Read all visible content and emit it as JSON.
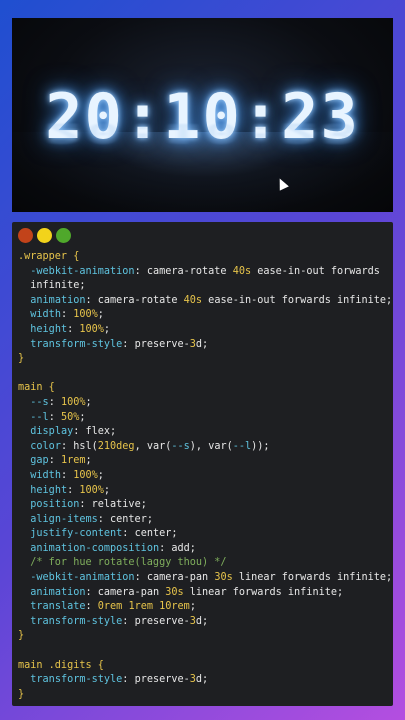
{
  "preview": {
    "clock_text": "20:10:23"
  },
  "editor": {
    "lines": [
      ".wrapper {",
      "  -webkit-animation: camera-rotate 40s ease-in-out forwards",
      "  infinite;",
      "  animation: camera-rotate 40s ease-in-out forwards infinite;",
      "  width: 100%;",
      "  height: 100%;",
      "  transform-style: preserve-3d;",
      "}",
      "",
      "main {",
      "  --s: 100%;",
      "  --l: 50%;",
      "  display: flex;",
      "  color: hsl(210deg, var(--s), var(--l));",
      "  gap: 1rem;",
      "  width: 100%;",
      "  height: 100%;",
      "  position: relative;",
      "  align-items: center;",
      "  justify-content: center;",
      "  animation-composition: add;",
      "  /* for hue rotate(laggy thou) */",
      "  -webkit-animation: camera-pan 30s linear forwards infinite;",
      "  animation: camera-pan 30s linear forwards infinite;",
      "  translate: 0rem 1rem 10rem;",
      "  transform-style: preserve-3d;",
      "}",
      "",
      "main .digits {",
      "  transform-style: preserve-3d;",
      "}"
    ]
  }
}
